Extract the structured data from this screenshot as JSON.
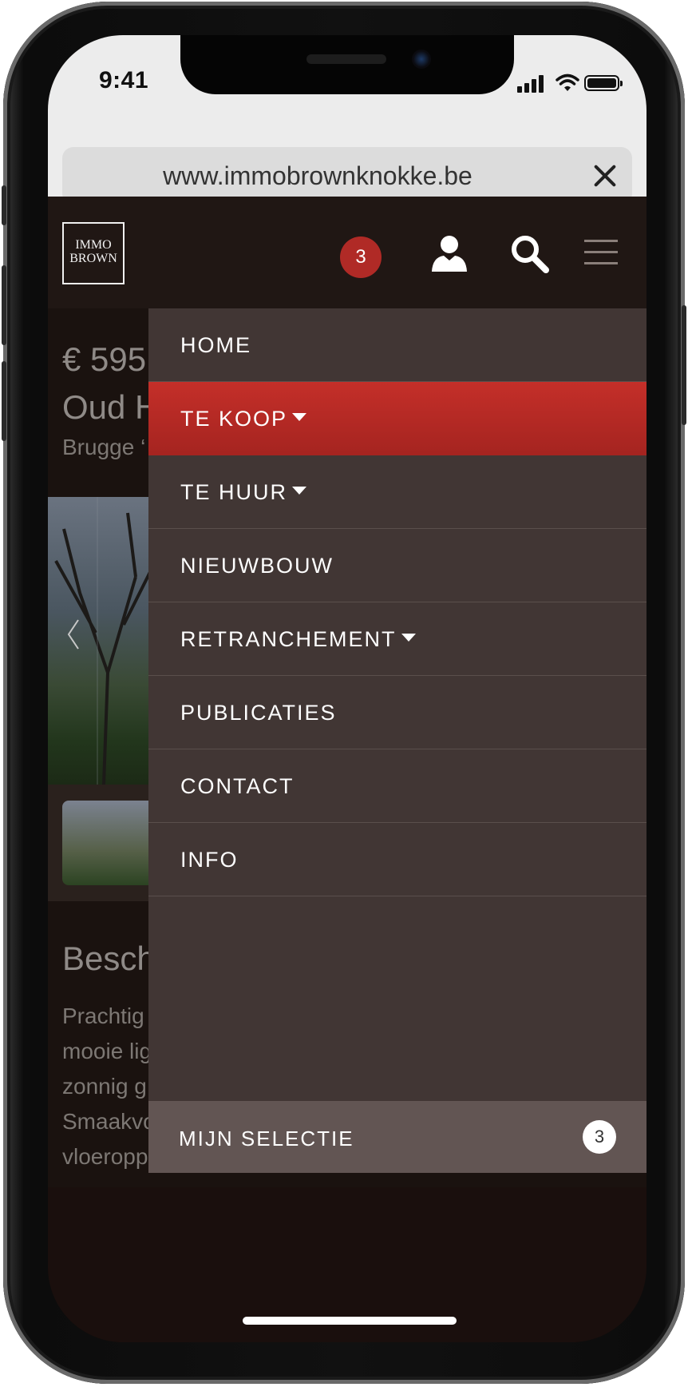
{
  "status": {
    "time": "9:41"
  },
  "browser": {
    "url": "www.immobrownknokke.be"
  },
  "header": {
    "logo_line1": "IMMO",
    "logo_line2": "BROWN",
    "selection_count": "3"
  },
  "listing": {
    "price": "€ 595",
    "title": "Oud H",
    "location": "Brugge ‘",
    "description_title": "Besch",
    "description_lines": [
      "Prachtig",
      "mooie lig",
      "zonnig g",
      "Smaakvo",
      "vloeropp"
    ]
  },
  "menu": {
    "items": [
      {
        "label": "HOME",
        "has_caret": false,
        "active": false
      },
      {
        "label": "TE KOOP",
        "has_caret": true,
        "active": true
      },
      {
        "label": "TE HUUR",
        "has_caret": true,
        "active": false
      },
      {
        "label": "NIEUWBOUW",
        "has_caret": false,
        "active": false
      },
      {
        "label": "RETRANCHEMENT",
        "has_caret": true,
        "active": false
      },
      {
        "label": "PUBLICATIES",
        "has_caret": false,
        "active": false
      },
      {
        "label": "CONTACT",
        "has_caret": false,
        "active": false
      },
      {
        "label": "INFO",
        "has_caret": false,
        "active": false
      }
    ],
    "selection_label": "MIJN SELECTIE",
    "selection_count": "3"
  },
  "colors": {
    "accent": "#b02a26",
    "menu_bg": "#413634",
    "header_bg": "#201714"
  }
}
